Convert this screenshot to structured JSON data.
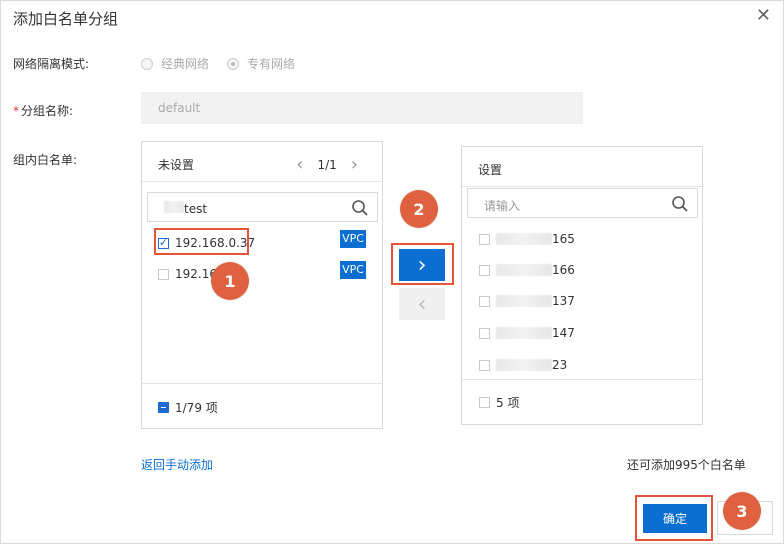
{
  "dialog": {
    "title": "添加白名单分组",
    "close_symbol": "✕"
  },
  "form": {
    "network_mode_label": "网络隔离模式:",
    "network_options": [
      {
        "label": "经典网络",
        "selected": false
      },
      {
        "label": "专有网络",
        "selected": true
      }
    ],
    "group_name_required": "*",
    "group_name_label": "分组名称:",
    "group_name_value": "default",
    "whitelist_label": "组内白名单:"
  },
  "left_panel": {
    "title": "未设置",
    "pager_prev": "‹",
    "page": "1/1",
    "pager_next": "›",
    "search_value": "test",
    "items": [
      {
        "ip": "192.168.0.37",
        "checked": true,
        "tag": "VPC"
      },
      {
        "ip": "192.168",
        "checked": false,
        "tag": "VPC"
      }
    ],
    "footer_count": "1/79 项"
  },
  "right_panel": {
    "title": "设置",
    "search_placeholder": "请输入",
    "items": [
      {
        "suffix": "165"
      },
      {
        "suffix": "166"
      },
      {
        "suffix": "137"
      },
      {
        "suffix": "147"
      },
      {
        "suffix": "23"
      }
    ],
    "footer_count": "5 项"
  },
  "transfer": {
    "right_arrow": "›",
    "left_arrow": "‹"
  },
  "badges": [
    "1",
    "2",
    "3"
  ],
  "footer": {
    "back_link": "返回手动添加",
    "remaining": "还可添加995个白名单",
    "ok_label": "确定"
  },
  "colors": {
    "primary": "#0a6fd1",
    "highlight": "#e5543a",
    "badge": "#e0613f"
  }
}
